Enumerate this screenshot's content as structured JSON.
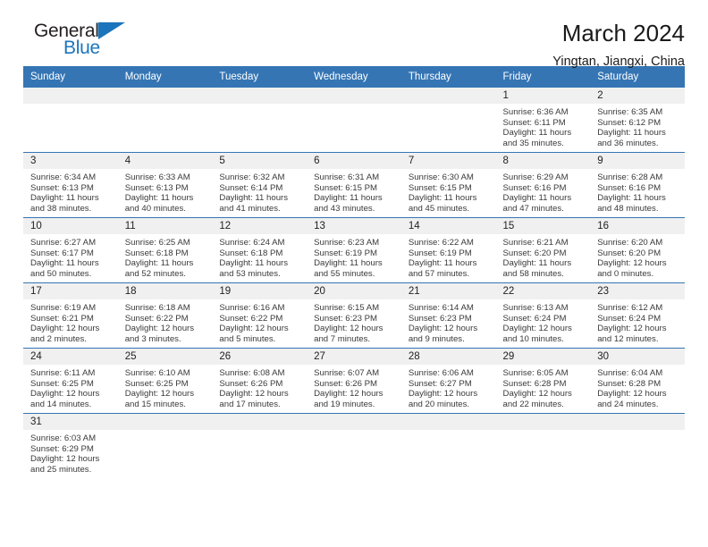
{
  "brand": {
    "name_part1": "General",
    "name_part2": "Blue",
    "triangle_icon": "triangle-icon",
    "accent_color": "#1b75bc"
  },
  "header": {
    "title": "March 2024",
    "subtitle": "Yingtan, Jiangxi, China"
  },
  "theme": {
    "header_blue": "#3575b4",
    "daynum_band": "#f0f0f0",
    "text": "#222222"
  },
  "weekdays": [
    "Sunday",
    "Monday",
    "Tuesday",
    "Wednesday",
    "Thursday",
    "Friday",
    "Saturday"
  ],
  "labels": {
    "sunrise_prefix": "Sunrise:",
    "sunset_prefix": "Sunset:",
    "daylight_prefix": "Daylight:"
  },
  "weeks": [
    [
      {
        "day": "",
        "line1": "",
        "line2": "",
        "line3": "",
        "line4": ""
      },
      {
        "day": "",
        "line1": "",
        "line2": "",
        "line3": "",
        "line4": ""
      },
      {
        "day": "",
        "line1": "",
        "line2": "",
        "line3": "",
        "line4": ""
      },
      {
        "day": "",
        "line1": "",
        "line2": "",
        "line3": "",
        "line4": ""
      },
      {
        "day": "",
        "line1": "",
        "line2": "",
        "line3": "",
        "line4": ""
      },
      {
        "day": "1",
        "line1": "Sunrise: 6:36 AM",
        "line2": "Sunset: 6:11 PM",
        "line3": "Daylight: 11 hours",
        "line4": "and 35 minutes."
      },
      {
        "day": "2",
        "line1": "Sunrise: 6:35 AM",
        "line2": "Sunset: 6:12 PM",
        "line3": "Daylight: 11 hours",
        "line4": "and 36 minutes."
      }
    ],
    [
      {
        "day": "3",
        "line1": "Sunrise: 6:34 AM",
        "line2": "Sunset: 6:13 PM",
        "line3": "Daylight: 11 hours",
        "line4": "and 38 minutes."
      },
      {
        "day": "4",
        "line1": "Sunrise: 6:33 AM",
        "line2": "Sunset: 6:13 PM",
        "line3": "Daylight: 11 hours",
        "line4": "and 40 minutes."
      },
      {
        "day": "5",
        "line1": "Sunrise: 6:32 AM",
        "line2": "Sunset: 6:14 PM",
        "line3": "Daylight: 11 hours",
        "line4": "and 41 minutes."
      },
      {
        "day": "6",
        "line1": "Sunrise: 6:31 AM",
        "line2": "Sunset: 6:15 PM",
        "line3": "Daylight: 11 hours",
        "line4": "and 43 minutes."
      },
      {
        "day": "7",
        "line1": "Sunrise: 6:30 AM",
        "line2": "Sunset: 6:15 PM",
        "line3": "Daylight: 11 hours",
        "line4": "and 45 minutes."
      },
      {
        "day": "8",
        "line1": "Sunrise: 6:29 AM",
        "line2": "Sunset: 6:16 PM",
        "line3": "Daylight: 11 hours",
        "line4": "and 47 minutes."
      },
      {
        "day": "9",
        "line1": "Sunrise: 6:28 AM",
        "line2": "Sunset: 6:16 PM",
        "line3": "Daylight: 11 hours",
        "line4": "and 48 minutes."
      }
    ],
    [
      {
        "day": "10",
        "line1": "Sunrise: 6:27 AM",
        "line2": "Sunset: 6:17 PM",
        "line3": "Daylight: 11 hours",
        "line4": "and 50 minutes."
      },
      {
        "day": "11",
        "line1": "Sunrise: 6:25 AM",
        "line2": "Sunset: 6:18 PM",
        "line3": "Daylight: 11 hours",
        "line4": "and 52 minutes."
      },
      {
        "day": "12",
        "line1": "Sunrise: 6:24 AM",
        "line2": "Sunset: 6:18 PM",
        "line3": "Daylight: 11 hours",
        "line4": "and 53 minutes."
      },
      {
        "day": "13",
        "line1": "Sunrise: 6:23 AM",
        "line2": "Sunset: 6:19 PM",
        "line3": "Daylight: 11 hours",
        "line4": "and 55 minutes."
      },
      {
        "day": "14",
        "line1": "Sunrise: 6:22 AM",
        "line2": "Sunset: 6:19 PM",
        "line3": "Daylight: 11 hours",
        "line4": "and 57 minutes."
      },
      {
        "day": "15",
        "line1": "Sunrise: 6:21 AM",
        "line2": "Sunset: 6:20 PM",
        "line3": "Daylight: 11 hours",
        "line4": "and 58 minutes."
      },
      {
        "day": "16",
        "line1": "Sunrise: 6:20 AM",
        "line2": "Sunset: 6:20 PM",
        "line3": "Daylight: 12 hours",
        "line4": "and 0 minutes."
      }
    ],
    [
      {
        "day": "17",
        "line1": "Sunrise: 6:19 AM",
        "line2": "Sunset: 6:21 PM",
        "line3": "Daylight: 12 hours",
        "line4": "and 2 minutes."
      },
      {
        "day": "18",
        "line1": "Sunrise: 6:18 AM",
        "line2": "Sunset: 6:22 PM",
        "line3": "Daylight: 12 hours",
        "line4": "and 3 minutes."
      },
      {
        "day": "19",
        "line1": "Sunrise: 6:16 AM",
        "line2": "Sunset: 6:22 PM",
        "line3": "Daylight: 12 hours",
        "line4": "and 5 minutes."
      },
      {
        "day": "20",
        "line1": "Sunrise: 6:15 AM",
        "line2": "Sunset: 6:23 PM",
        "line3": "Daylight: 12 hours",
        "line4": "and 7 minutes."
      },
      {
        "day": "21",
        "line1": "Sunrise: 6:14 AM",
        "line2": "Sunset: 6:23 PM",
        "line3": "Daylight: 12 hours",
        "line4": "and 9 minutes."
      },
      {
        "day": "22",
        "line1": "Sunrise: 6:13 AM",
        "line2": "Sunset: 6:24 PM",
        "line3": "Daylight: 12 hours",
        "line4": "and 10 minutes."
      },
      {
        "day": "23",
        "line1": "Sunrise: 6:12 AM",
        "line2": "Sunset: 6:24 PM",
        "line3": "Daylight: 12 hours",
        "line4": "and 12 minutes."
      }
    ],
    [
      {
        "day": "24",
        "line1": "Sunrise: 6:11 AM",
        "line2": "Sunset: 6:25 PM",
        "line3": "Daylight: 12 hours",
        "line4": "and 14 minutes."
      },
      {
        "day": "25",
        "line1": "Sunrise: 6:10 AM",
        "line2": "Sunset: 6:25 PM",
        "line3": "Daylight: 12 hours",
        "line4": "and 15 minutes."
      },
      {
        "day": "26",
        "line1": "Sunrise: 6:08 AM",
        "line2": "Sunset: 6:26 PM",
        "line3": "Daylight: 12 hours",
        "line4": "and 17 minutes."
      },
      {
        "day": "27",
        "line1": "Sunrise: 6:07 AM",
        "line2": "Sunset: 6:26 PM",
        "line3": "Daylight: 12 hours",
        "line4": "and 19 minutes."
      },
      {
        "day": "28",
        "line1": "Sunrise: 6:06 AM",
        "line2": "Sunset: 6:27 PM",
        "line3": "Daylight: 12 hours",
        "line4": "and 20 minutes."
      },
      {
        "day": "29",
        "line1": "Sunrise: 6:05 AM",
        "line2": "Sunset: 6:28 PM",
        "line3": "Daylight: 12 hours",
        "line4": "and 22 minutes."
      },
      {
        "day": "30",
        "line1": "Sunrise: 6:04 AM",
        "line2": "Sunset: 6:28 PM",
        "line3": "Daylight: 12 hours",
        "line4": "and 24 minutes."
      }
    ],
    [
      {
        "day": "31",
        "line1": "Sunrise: 6:03 AM",
        "line2": "Sunset: 6:29 PM",
        "line3": "Daylight: 12 hours",
        "line4": "and 25 minutes."
      },
      {
        "day": "",
        "line1": "",
        "line2": "",
        "line3": "",
        "line4": ""
      },
      {
        "day": "",
        "line1": "",
        "line2": "",
        "line3": "",
        "line4": ""
      },
      {
        "day": "",
        "line1": "",
        "line2": "",
        "line3": "",
        "line4": ""
      },
      {
        "day": "",
        "line1": "",
        "line2": "",
        "line3": "",
        "line4": ""
      },
      {
        "day": "",
        "line1": "",
        "line2": "",
        "line3": "",
        "line4": ""
      },
      {
        "day": "",
        "line1": "",
        "line2": "",
        "line3": "",
        "line4": ""
      }
    ]
  ]
}
